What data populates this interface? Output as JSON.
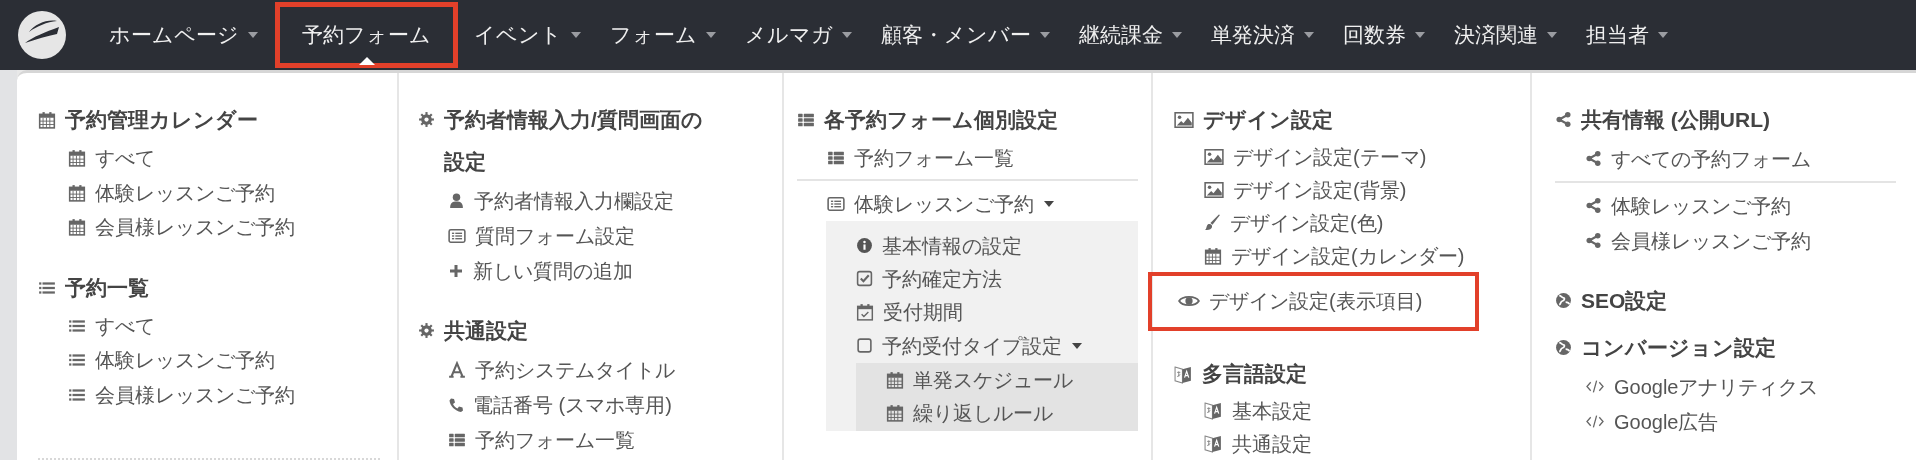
{
  "nav": {
    "items": [
      {
        "label": "ホームページ",
        "dropdown": true,
        "selected": false,
        "highlighted": false
      },
      {
        "label": "予約フォーム",
        "dropdown": false,
        "selected": true,
        "highlighted": true
      },
      {
        "label": "イベント",
        "dropdown": true,
        "selected": false,
        "highlighted": false
      },
      {
        "label": "フォーム",
        "dropdown": true,
        "selected": false,
        "highlighted": false
      },
      {
        "label": "メルマガ",
        "dropdown": true,
        "selected": false,
        "highlighted": false
      },
      {
        "label": "顧客・メンバー",
        "dropdown": true,
        "selected": false,
        "highlighted": false
      },
      {
        "label": "継続課金",
        "dropdown": true,
        "selected": false,
        "highlighted": false
      },
      {
        "label": "単発決済",
        "dropdown": true,
        "selected": false,
        "highlighted": false
      },
      {
        "label": "回数券",
        "dropdown": true,
        "selected": false,
        "highlighted": false
      },
      {
        "label": "決済関連",
        "dropdown": true,
        "selected": false,
        "highlighted": false
      },
      {
        "label": "担当者",
        "dropdown": true,
        "selected": false,
        "highlighted": false
      }
    ]
  },
  "dropdown": {
    "columns": [
      [
        {
          "kind": "heading",
          "label": "予約管理カレンダー"
        },
        {
          "kind": "item",
          "label": "すべて",
          "highlighted": false
        },
        {
          "kind": "item",
          "label": "体験レッスンご予約",
          "highlighted": false
        },
        {
          "kind": "item",
          "label": "会員様レッスンご予約",
          "highlighted": false
        },
        {
          "kind": "heading",
          "label": "予約一覧"
        },
        {
          "kind": "item",
          "label": "すべて",
          "highlighted": false
        },
        {
          "kind": "item",
          "label": "体験レッスンご予約",
          "highlighted": false
        },
        {
          "kind": "item",
          "label": "会員様レッスンご予約",
          "highlighted": false
        },
        {
          "kind": "dotted-divider"
        }
      ],
      [
        {
          "kind": "heading",
          "label": "予約者情報入力/質問画面の設定"
        },
        {
          "kind": "item",
          "label": "予約者情報入力欄設定",
          "highlighted": false
        },
        {
          "kind": "item",
          "label": "質問フォーム設定",
          "highlighted": false
        },
        {
          "kind": "item",
          "label": "新しい質問の追加",
          "highlighted": false
        },
        {
          "kind": "heading",
          "label": "共通設定"
        },
        {
          "kind": "item",
          "label": "予約システムタイトル",
          "highlighted": false
        },
        {
          "kind": "item",
          "label": "電話番号 (スマホ専用)",
          "highlighted": false
        },
        {
          "kind": "item",
          "label": "予約フォーム一覧",
          "highlighted": false
        }
      ],
      [
        {
          "kind": "heading",
          "label": "各予約フォーム個別設定"
        },
        {
          "kind": "item",
          "label": "予約フォーム一覧",
          "highlighted": false
        },
        {
          "kind": "divider"
        },
        {
          "kind": "folder",
          "label": "体験レッスンご予約",
          "expanded": true,
          "children": [
            {
              "kind": "item",
              "label": "基本情報の設定",
              "highlighted": false
            },
            {
              "kind": "item",
              "label": "予約確定方法",
              "highlighted": false
            },
            {
              "kind": "item",
              "label": "受付期間",
              "highlighted": false
            },
            {
              "kind": "folder",
              "label": "予約受付タイプ設定",
              "expanded": true,
              "children": [
                {
                  "kind": "item",
                  "label": "単発スケジュール",
                  "highlighted": false
                },
                {
                  "kind": "item",
                  "label": "繰り返しルール",
                  "highlighted": false
                }
              ]
            }
          ]
        }
      ],
      [
        {
          "kind": "heading",
          "label": "デザイン設定"
        },
        {
          "kind": "item",
          "label": "デザイン設定(テーマ)",
          "highlighted": false
        },
        {
          "kind": "item",
          "label": "デザイン設定(背景)",
          "highlighted": false
        },
        {
          "kind": "item",
          "label": "デザイン設定(色)",
          "highlighted": false
        },
        {
          "kind": "item",
          "label": "デザイン設定(カレンダー)",
          "highlighted": false
        },
        {
          "kind": "item",
          "label": "デザイン設定(表示項目)",
          "highlighted": true
        },
        {
          "kind": "heading",
          "label": "多言語設定"
        },
        {
          "kind": "item",
          "label": "基本設定",
          "highlighted": false
        },
        {
          "kind": "item",
          "label": "共通設定",
          "highlighted": false
        }
      ],
      [
        {
          "kind": "heading",
          "label": "共有情報 (公開URL)"
        },
        {
          "kind": "item",
          "label": "すべての予約フォーム",
          "highlighted": false
        },
        {
          "kind": "divider"
        },
        {
          "kind": "item",
          "label": "体験レッスンご予約",
          "highlighted": false
        },
        {
          "kind": "item",
          "label": "会員様レッスンご予約",
          "highlighted": false
        },
        {
          "kind": "heading",
          "label": "SEO設定"
        },
        {
          "kind": "heading",
          "label": "コンバージョン設定"
        },
        {
          "kind": "item",
          "label": "Googleアナリティクス",
          "highlighted": false
        },
        {
          "kind": "item",
          "label": "Google広告",
          "highlighted": false
        }
      ]
    ]
  }
}
